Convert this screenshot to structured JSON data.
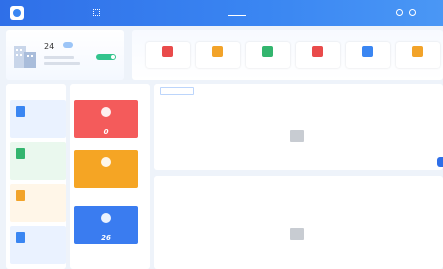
{
  "header": {
    "app_title": "",
    "nav": [
      {
        "label": ""
      },
      {
        "label": ""
      },
      {
        "label": ""
      },
      {
        "label": ""
      },
      {
        "label": ""
      },
      {
        "label": ""
      },
      {
        "label": ""
      },
      {
        "label": ""
      }
    ],
    "active_nav_index": 4,
    "user_name": ""
  },
  "weather": {
    "temperature": "24",
    "status": ""
  },
  "quick_entry": {
    "title": "",
    "items": [
      {
        "label": "",
        "icon": "user-icon",
        "color": "#e94b4b"
      },
      {
        "label": "",
        "icon": "grid-icon",
        "color": "#f2a329"
      },
      {
        "label": "",
        "icon": "document-icon",
        "color": "#33b56e"
      },
      {
        "label": "",
        "icon": "building-icon",
        "color": "#e94b4b"
      },
      {
        "label": "",
        "icon": "home-icon",
        "color": "#3a86f2"
      },
      {
        "label": "",
        "icon": "people-icon",
        "color": "#f2a329"
      }
    ]
  },
  "left_section": {
    "title": "",
    "cards": [
      {
        "label": "",
        "icon": "document-icon",
        "bg": "#eaf2ff",
        "color": "#3a86f2"
      },
      {
        "label": "",
        "icon": "document-icon",
        "bg": "#eaf8ee",
        "color": "#33b56e"
      },
      {
        "label": "",
        "icon": "document-icon",
        "bg": "#fff6e8",
        "color": "#f2a329"
      },
      {
        "label": "",
        "icon": "document-icon",
        "bg": "#eaf2ff",
        "color": "#3a86f2"
      }
    ]
  },
  "middle_section": {
    "title": "",
    "cards": [
      {
        "label": "",
        "number": "0",
        "color": "#f45b5b"
      },
      {
        "label": "",
        "number": "",
        "color": "#f5a524"
      },
      {
        "label": "",
        "number": "26",
        "color": "#3a7cf0"
      }
    ]
  },
  "tasks_panel": {
    "tabs": [
      {
        "label": ""
      },
      {
        "label": ""
      }
    ],
    "empty_text": ""
  },
  "notice_panel": {
    "title": "",
    "empty_text": ""
  }
}
